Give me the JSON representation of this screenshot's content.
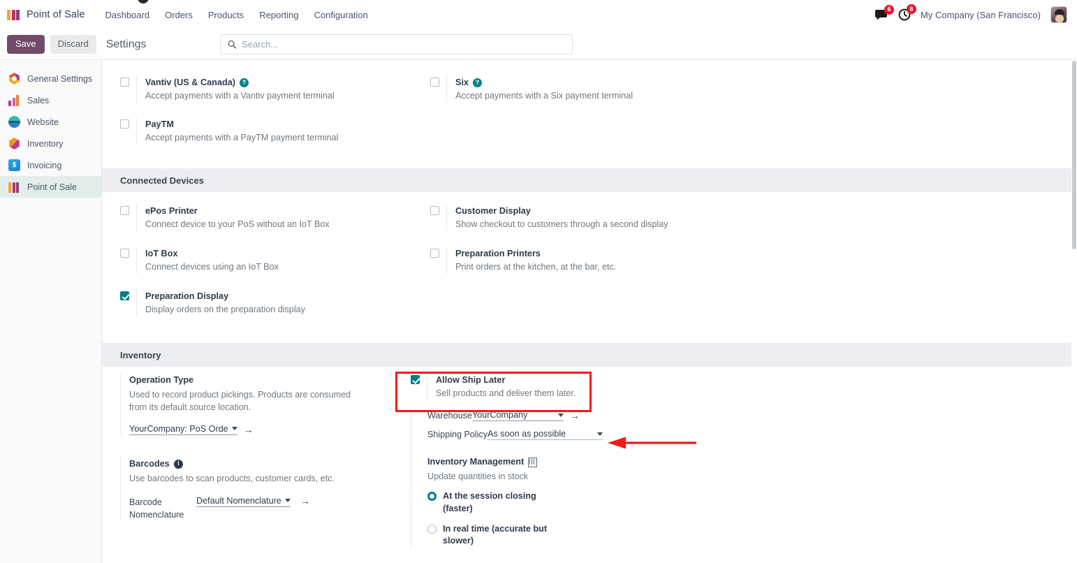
{
  "app": {
    "brand": "Point of Sale",
    "menu": [
      "Dashboard",
      "Orders",
      "Products",
      "Reporting",
      "Configuration"
    ],
    "messages_badge": "6",
    "activities_badge": "8",
    "company": "My Company (San Francisco)"
  },
  "control_panel": {
    "save_label": "Save",
    "discard_label": "Discard",
    "title": "Settings",
    "search_placeholder": "Search...",
    "search_value": ""
  },
  "sidebar": {
    "items": [
      {
        "label": "General Settings",
        "icon": "general-settings-icon",
        "active": false
      },
      {
        "label": "Sales",
        "icon": "sales-icon",
        "active": false
      },
      {
        "label": "Website",
        "icon": "website-icon",
        "active": false
      },
      {
        "label": "Inventory",
        "icon": "inventory-icon",
        "active": false
      },
      {
        "label": "Invoicing",
        "icon": "invoicing-icon",
        "active": false
      },
      {
        "label": "Point of Sale",
        "icon": "point-of-sale-icon",
        "active": true
      }
    ]
  },
  "payment_terminals": {
    "options": [
      {
        "title": "Vantiv (US & Canada)",
        "desc": "Accept payments with a Vantiv payment terminal",
        "checked": false,
        "help": true
      },
      {
        "title": "Six",
        "desc": "Accept payments with a Six payment terminal",
        "checked": false,
        "help": true
      },
      {
        "title": "PayTM",
        "desc": "Accept payments with a PayTM payment terminal",
        "checked": false,
        "help": false
      }
    ]
  },
  "connected_devices": {
    "heading": "Connected Devices",
    "options": [
      {
        "title": "ePos Printer",
        "desc": "Connect device to your PoS without an IoT Box",
        "checked": false
      },
      {
        "title": "Customer Display",
        "desc": "Show checkout to customers through a second display",
        "checked": false
      },
      {
        "title": "IoT Box",
        "desc": "Connect devices using an IoT Box",
        "checked": false
      },
      {
        "title": "Preparation Printers",
        "desc": "Print orders at the kitchen, at the bar, etc.",
        "checked": false
      },
      {
        "title": "Preparation Display",
        "desc": "Display orders on the preparation display",
        "checked": true
      }
    ]
  },
  "inventory": {
    "heading": "Inventory",
    "operation_type": {
      "title": "Operation Type",
      "desc": "Used to record product pickings. Products are consumed from its default source location.",
      "value": "YourCompany: PoS Orde"
    },
    "barcodes": {
      "title": "Barcodes",
      "desc": "Use barcodes to scan products, customer cards, etc.",
      "field_label": "Barcode Nomenclature",
      "value": "Default Nomenclature"
    },
    "allow_ship_later": {
      "title": "Allow Ship Later",
      "desc": "Sell products and deliver them later.",
      "checked": true
    },
    "warehouse": {
      "label": "Warehouse",
      "value": "YourCompany"
    },
    "shipping_policy": {
      "label": "Shipping Policy",
      "value": "As soon as possible"
    },
    "inventory_management": {
      "title": "Inventory Management",
      "desc": "Update quantities in stock",
      "options": [
        {
          "label": "At the session closing (faster)",
          "selected": true
        },
        {
          "label": "In real time (accurate but slower)",
          "selected": false
        }
      ]
    }
  },
  "annotations": {
    "highlight_color": "#ee1c1c",
    "accent_teal": "#017e84",
    "brand_purple": "#714b67"
  }
}
